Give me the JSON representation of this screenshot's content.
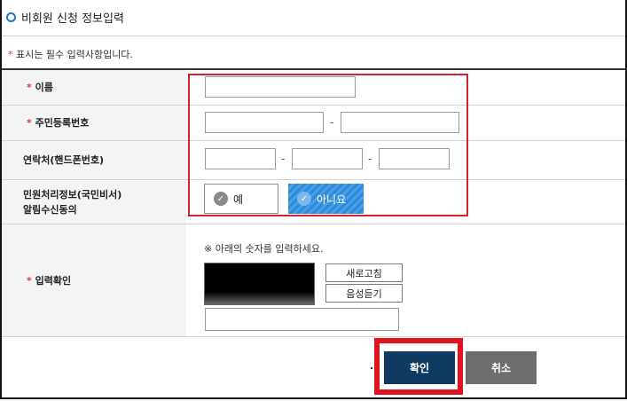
{
  "title": "비회원 신청 정보입력",
  "required_note": {
    "star": "*",
    "text": " 표시는 필수 입력사항입니다."
  },
  "fields": {
    "name": {
      "star": "*",
      "label": "이름",
      "value": ""
    },
    "resident_number": {
      "star": "*",
      "label": "주민등록번호",
      "part1": "",
      "part2": "",
      "separator": "-"
    },
    "phone": {
      "label": "연락처(핸드폰번호)",
      "part1": "",
      "part2": "",
      "part3": "",
      "separator": "-"
    },
    "consent": {
      "label_line1": "민원처리정보(국민비서)",
      "label_line2": "알림수신동의",
      "yes_label": "예",
      "no_label": "아니요",
      "selected": "아니요",
      "check_glyph": "✓"
    },
    "captcha": {
      "star": "*",
      "label": "입력확인",
      "instruction": "※ 아래의 숫자를 입력하세요.",
      "refresh_label": "새로고침",
      "audio_label": "음성듣기",
      "value": ""
    }
  },
  "actions": {
    "confirm_label": "확인",
    "cancel_label": "취소"
  },
  "colors": {
    "accent": "#2d8bdb",
    "required": "#e03a3a",
    "confirm_bg": "#0f3a62",
    "cancel_bg": "#6d6d6d",
    "highlight": "#d6222a"
  }
}
